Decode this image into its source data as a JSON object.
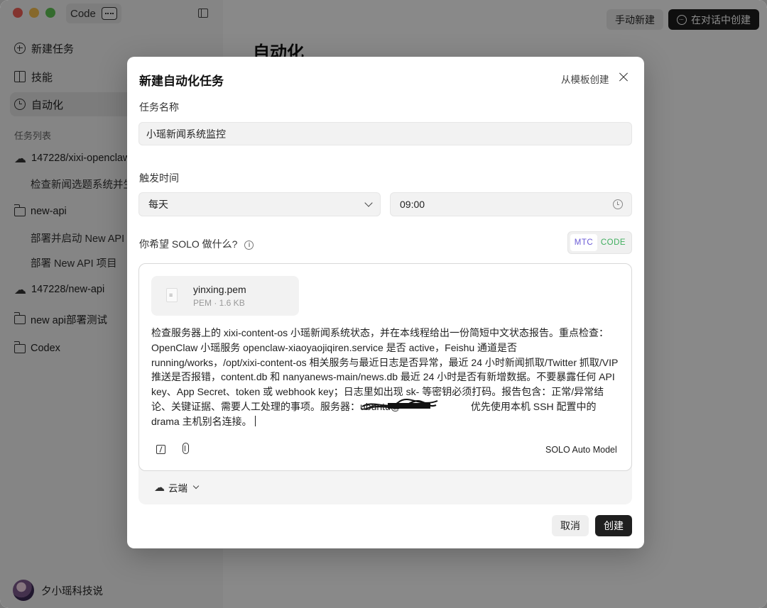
{
  "app": {
    "name": "Code"
  },
  "sidebar": {
    "nav": [
      {
        "label": "新建任务",
        "icon": "plus-circle-icon"
      },
      {
        "label": "技能",
        "icon": "book-icon"
      },
      {
        "label": "自动化",
        "icon": "clock-icon",
        "active": true
      }
    ],
    "section_label": "任务列表",
    "tree": [
      {
        "label": "147228/xixi-openclaw",
        "icon": "cloud-icon",
        "children": [
          "检查新闻选题系统并生"
        ]
      },
      {
        "label": "new-api",
        "icon": "folder-icon",
        "children": [
          "部署并启动 New API 项",
          "部署 New API 项目"
        ]
      },
      {
        "label": "147228/new-api",
        "icon": "cloud-icon",
        "children": []
      },
      {
        "label": "new api部署测试",
        "icon": "folder-icon",
        "children": []
      },
      {
        "label": "Codex",
        "icon": "folder-icon",
        "children": []
      }
    ],
    "user": {
      "name": "夕小瑶科技说"
    }
  },
  "main": {
    "title": "自动化",
    "manual_button": "手动新建",
    "chat_button": "在对话中创建"
  },
  "modal": {
    "title": "新建自动化任务",
    "template_link": "从模板创建",
    "name_label": "任务名称",
    "name_value": "小瑶新闻系统监控",
    "trigger_label": "触发时间",
    "frequency": "每天",
    "time": "09:00",
    "prompt_label": "你希望 SOLO 做什么?",
    "mode": {
      "mtc": "MTC",
      "code": "CODE"
    },
    "attachment": {
      "name": "yinxing.pem",
      "meta": "PEM · 1.6 KB"
    },
    "prompt_text_a": "检查服务器上的 xixi-content-os 小瑶新闻系统状态，并在本线程给出一份简短中文状态报告。重点检查：OpenClaw 小瑶服务 openclaw-xiaoyaojiqiren.service 是否 active，Feishu 通道是否 running/works，/opt/xixi-content-os 相关服务与最近日志是否异常，最近 24 小时新闻抓取/Twitter 抓取/VIP 推送是否报错，content.db 和 nanyanews-main/news.db 最近 24 小时是否有新增数据。不要暴露任何 API key、App Secret、token 或 webhook key；日志里如出现 sk- 等密钥必须打码。报告包含：正常/异常结论、关键证据、需要人工处理的事项。服务器：ubuntu@",
    "prompt_text_b": " 优先使用本机 SSH 配置中的 drama 主机别名连接。",
    "model": "SOLO Auto Model",
    "environment": "云端",
    "cancel": "取消",
    "create": "创建"
  }
}
